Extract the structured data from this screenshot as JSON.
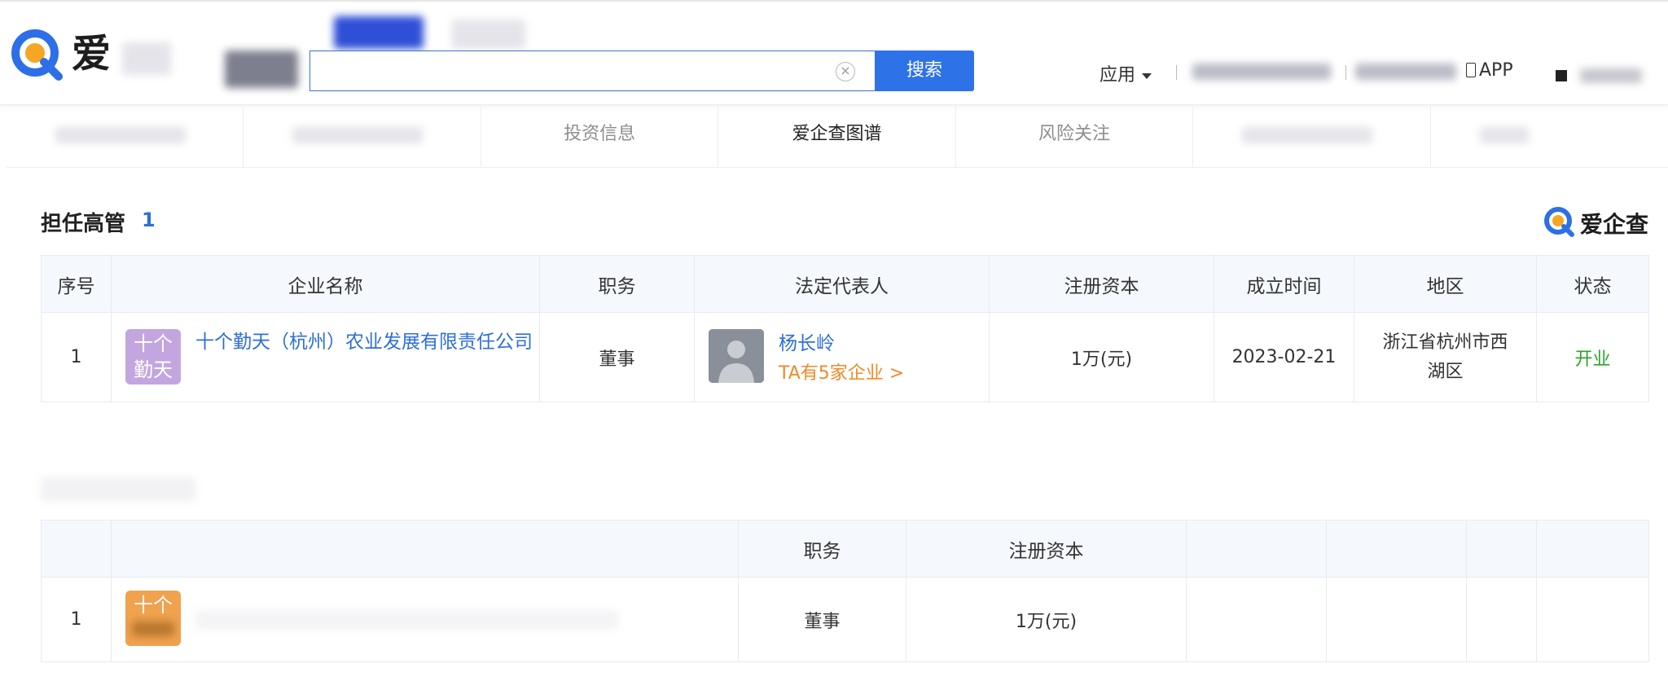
{
  "header": {
    "logo_text": "爱",
    "search": {
      "value": "",
      "placeholder": "",
      "clear_icon": "×",
      "button_label": "搜索"
    },
    "apps_label": "应用",
    "app_label": "APP",
    "icons": {
      "search-clear": "close-icon",
      "apps-caret": "chevron-down-icon",
      "app": "phone-icon"
    }
  },
  "tabs": [
    {
      "label": ""
    },
    {
      "label": ""
    },
    {
      "label": "投资信息"
    },
    {
      "label": "爱企查图谱",
      "active": true
    },
    {
      "label": "风险关注"
    },
    {
      "label": ""
    },
    {
      "label": ""
    }
  ],
  "section": {
    "title": "担任高管",
    "count": "1",
    "brand": "爱企查"
  },
  "table1": {
    "headers": [
      "序号",
      "企业名称",
      "职务",
      "法定代表人",
      "注册资本",
      "成立时间",
      "地区",
      "状态"
    ],
    "rows": [
      {
        "index": "1",
        "logo_line1": "十个",
        "logo_line2": "勤天",
        "company": "十个勤天（杭州）农业发展有限责任公司",
        "position": "董事",
        "rep_name": "杨长岭",
        "rep_link": "TA有5家企业 >",
        "capital": "1万(元)",
        "founded": "2023-02-21",
        "region": "浙江省杭州市西湖区",
        "status": "开业"
      }
    ]
  },
  "table2": {
    "headers": [
      "",
      "",
      "职务",
      "注册资本",
      "",
      "",
      "",
      ""
    ],
    "rows": [
      {
        "index": "1",
        "logo_line1": "十个",
        "company": "",
        "position": "董事",
        "capital": "1万(元)"
      }
    ]
  },
  "colors": {
    "accent": "#2e72e8",
    "link": "#2e6fd8",
    "orange": "#f08a28",
    "status_green": "#2ca32c",
    "header_bg": "#f5f8fd"
  }
}
